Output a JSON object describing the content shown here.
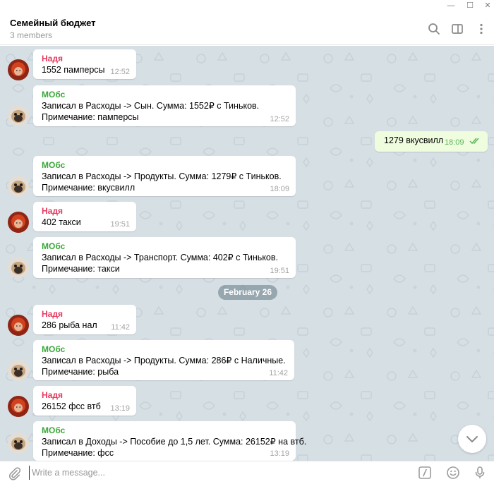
{
  "window": {
    "min_glyph": "—",
    "max_glyph": "☐",
    "close_glyph": "✕"
  },
  "header": {
    "title": "Семейный бюджет",
    "subtitle": "3 members",
    "icons": [
      "search-icon",
      "sidebar-toggle-icon",
      "more-vertical-icon"
    ]
  },
  "messages": [
    {
      "sender": "Надя",
      "lines": [
        "1552 памперсы"
      ],
      "time": "12:52"
    },
    {
      "sender": "МОбс",
      "lines": [
        "Записал в Расходы -> Сын. Сумма: 1552₽ с Тиньков.",
        "Примечание: памперсы"
      ],
      "time": "12:52"
    },
    {
      "sender": "МОбс",
      "lines": [
        "Записал в Расходы -> Продукты. Сумма: 1279₽ с Тиньков.",
        "Примечание: вкусвилл"
      ],
      "time": "18:09"
    },
    {
      "sender": "Надя",
      "lines": [
        "402 такси"
      ],
      "time": "19:51"
    },
    {
      "sender": "МОбс",
      "lines": [
        "Записал в Расходы -> Транспорт. Сумма: 402₽ с Тиньков.",
        "Примечание: такси"
      ],
      "time": "19:51"
    },
    {
      "sender": "Надя",
      "lines": [
        "286 рыба нал"
      ],
      "time": "11:42"
    },
    {
      "sender": "МОбс",
      "lines": [
        "Записал в Расходы -> Продукты. Сумма: 286₽ с Наличные.",
        "Примечание: рыба"
      ],
      "time": "11:42"
    },
    {
      "sender": "Надя",
      "lines": [
        "26152 фсс втб"
      ],
      "time": "13:19"
    },
    {
      "sender": "МОбс",
      "lines": [
        "Записал в Доходы -> Пособие до 1,5 лет. Сумма: 26152₽ на втб.",
        "Примечание: фсс"
      ],
      "time": "13:19"
    }
  ],
  "outgoing": {
    "text": "1279 вкусвилл",
    "time": "18:09",
    "status_icon": "double-check-icon"
  },
  "date_separator": "February 26",
  "composer": {
    "placeholder": "Write a message...",
    "icons": [
      "paperclip-icon",
      "commands-icon",
      "emoji-icon",
      "microphone-icon"
    ]
  },
  "colors": {
    "chat_bg": "#d6dfe4",
    "nadya_name": "#e6395f",
    "bot_name": "#3aa83a",
    "outgoing_bg": "#effdde",
    "check": "#5db55d"
  }
}
